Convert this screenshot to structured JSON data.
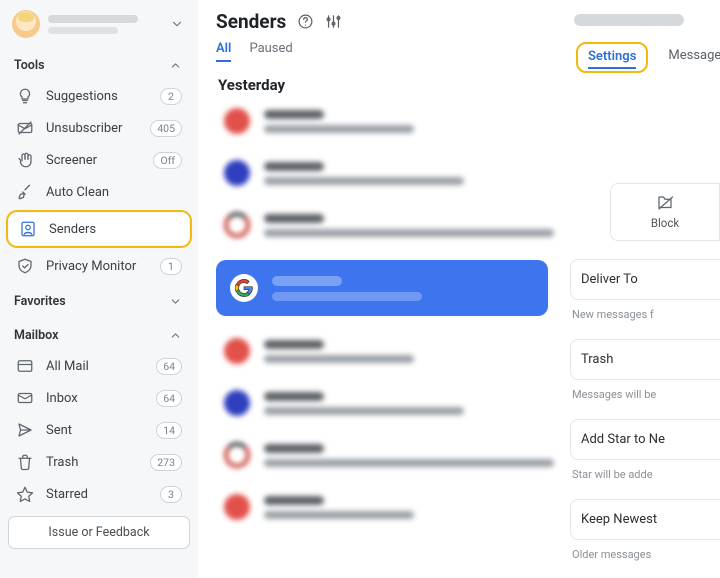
{
  "sidebar": {
    "sections": {
      "tools": {
        "label": "Tools",
        "items": [
          {
            "icon": "lightbulb",
            "label": "Suggestions",
            "badge": "2"
          },
          {
            "icon": "mail-off",
            "label": "Unsubscriber",
            "badge": "405"
          },
          {
            "icon": "hand",
            "label": "Screener",
            "badge": "Off"
          },
          {
            "icon": "broom",
            "label": "Auto Clean",
            "badge": ""
          },
          {
            "icon": "contact",
            "label": "Senders",
            "badge": "",
            "active": true
          },
          {
            "icon": "shield",
            "label": "Privacy Monitor",
            "badge": "1"
          }
        ]
      },
      "favorites": {
        "label": "Favorites"
      },
      "mailbox": {
        "label": "Mailbox",
        "items": [
          {
            "icon": "inbox-all",
            "label": "All Mail",
            "badge": "64"
          },
          {
            "icon": "envelope",
            "label": "Inbox",
            "badge": "64"
          },
          {
            "icon": "send",
            "label": "Sent",
            "badge": "14"
          },
          {
            "icon": "trash",
            "label": "Trash",
            "badge": "273"
          },
          {
            "icon": "star",
            "label": "Starred",
            "badge": "3"
          }
        ]
      }
    },
    "feedback_label": "Issue or Feedback"
  },
  "main": {
    "title": "Senders",
    "tabs": [
      {
        "label": "All",
        "active": true
      },
      {
        "label": "Paused",
        "active": false
      }
    ],
    "group_label": "Yesterday",
    "senders": [
      {
        "avatar_color": "#e2504a",
        "line2_w": 150
      },
      {
        "avatar_color": "#2f3fbe",
        "line2_w": 200
      },
      {
        "avatar_color": "ring",
        "line2_w": 290
      },
      {
        "selected": true,
        "avatar": "google"
      },
      {
        "avatar_color": "#e2504a",
        "line2_w": 150
      },
      {
        "avatar_color": "#2f3fbe",
        "line2_w": 200
      },
      {
        "avatar_color": "ring",
        "line2_w": 290
      },
      {
        "avatar_color": "#e2504a",
        "line2_w": 150
      }
    ]
  },
  "right": {
    "tabs": {
      "settings": "Settings",
      "messages": "Messages"
    },
    "block_label": "Block",
    "rows": [
      {
        "label": "Deliver To",
        "note": "New messages f"
      },
      {
        "label": "Trash",
        "note": "Messages will be"
      },
      {
        "label": "Add Star to Ne",
        "note": "Star will be adde"
      },
      {
        "label": "Keep Newest",
        "note": "Older messages"
      }
    ]
  }
}
